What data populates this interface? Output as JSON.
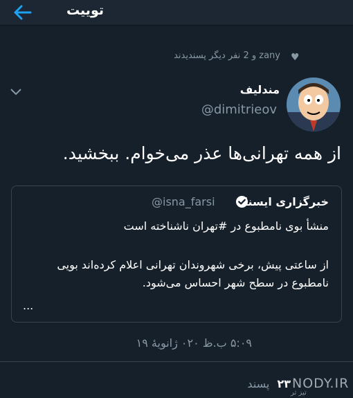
{
  "header": {
    "title": "توییت",
    "back_icon": "arrow-left-icon",
    "accent": "#1da1f2"
  },
  "likes": {
    "text": "zany و 2 نفر دیگر پسندیدند",
    "icon": "heart-icon"
  },
  "author": {
    "display_name": "مندلیف",
    "username": "@dimitrieov"
  },
  "tweet": {
    "text": "از همه تهرانی‌ها عذر می‌خوام. ببخشید."
  },
  "quote": {
    "name": "خبرگزاری ایسنا",
    "handle": "@isna_farsi",
    "line1": "منشأ بوی نامطبوع در #تهران ناشناخته است",
    "line2": "از ساعتی پیش، برخی شهروندان تهرانی اعلام کرده‌اند بویی",
    "line3": "نامطبوع در سطح شهر احساس می‌شود.",
    "ellipsis": "..."
  },
  "timestamp": "۵:۰۹ ب.ظ ۰۲۰ ژانویهٔ ۱۹",
  "stats": {
    "likes_count": "۲۳",
    "likes_label": "پسند"
  },
  "watermark": {
    "text": "NODY.IR",
    "sub": "تیز تر"
  }
}
